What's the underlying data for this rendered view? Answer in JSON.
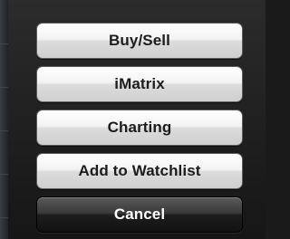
{
  "action_sheet": {
    "buttons": [
      {
        "label": "Buy/Sell",
        "style": "light"
      },
      {
        "label": "iMatrix",
        "style": "light"
      },
      {
        "label": "Charting",
        "style": "light"
      },
      {
        "label": "Add to Watchlist",
        "style": "light"
      },
      {
        "label": "Cancel",
        "style": "dark"
      }
    ]
  },
  "colors": {
    "sheet_background": "#1a1a1a",
    "light_button_text": "#1c1c1c",
    "cancel_button_text": "#ffffff"
  }
}
